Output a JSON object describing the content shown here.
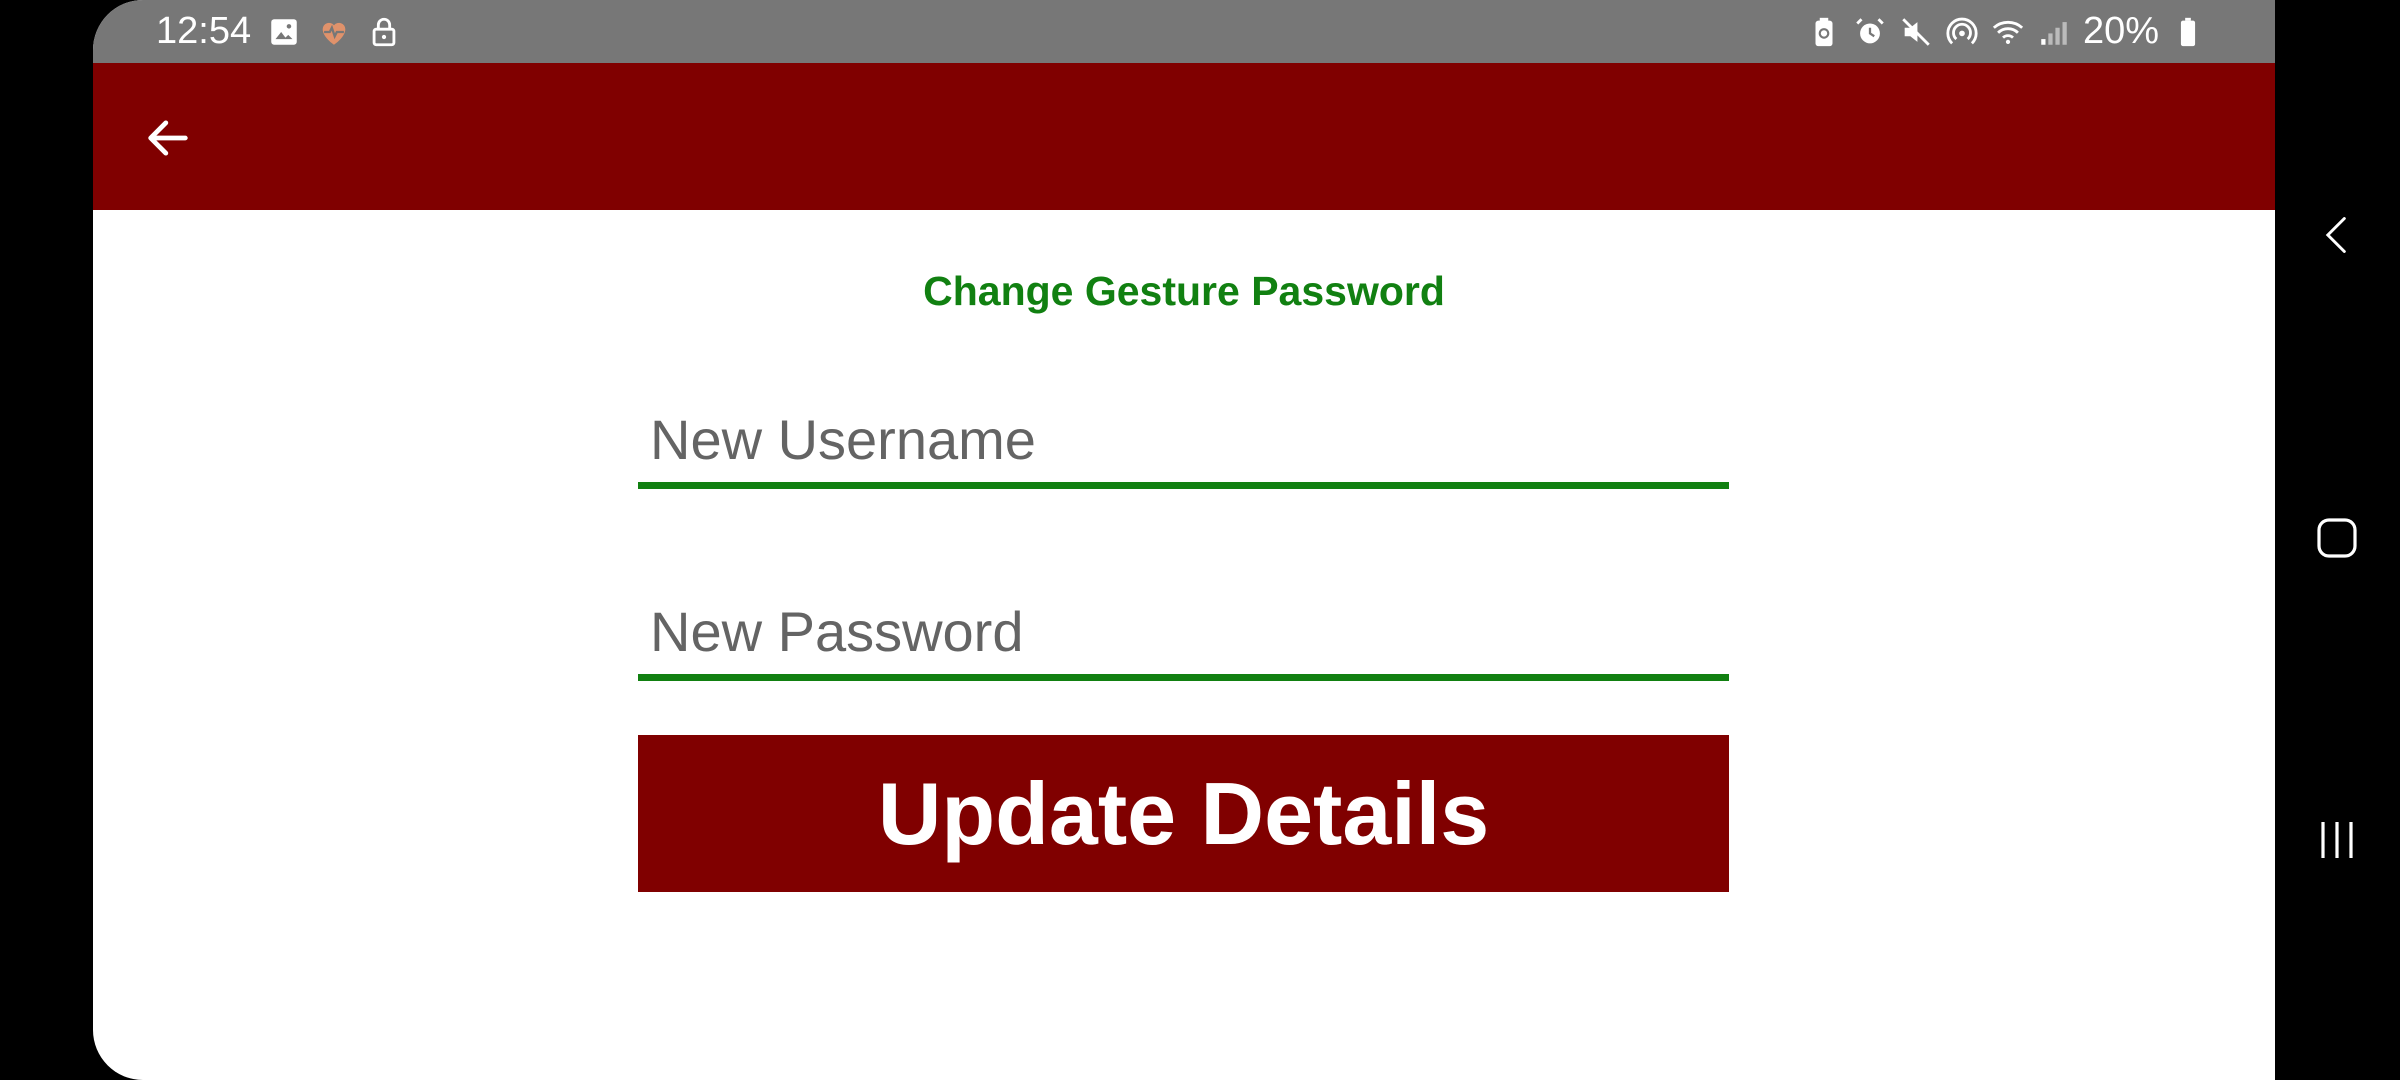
{
  "status_bar": {
    "time": "12:54",
    "left_icons": [
      "image-icon",
      "health-heart-icon",
      "lock-icon"
    ],
    "right_icons": [
      "battery-saver-icon",
      "alarm-icon",
      "mute-icon",
      "hotspot-icon",
      "wifi-icon",
      "signal-icon"
    ],
    "battery_percent": "20%"
  },
  "app_bar": {
    "back_icon": "arrow-left-icon",
    "color": "#800000"
  },
  "form": {
    "title": "Change Gesture Password",
    "username": {
      "placeholder": "New Username",
      "value": ""
    },
    "password": {
      "placeholder": "New Password",
      "value": ""
    },
    "submit_label": "Update Details",
    "accent_color": "#118011"
  },
  "nav_bar": {
    "icons": [
      "nav-back-icon",
      "nav-home-icon",
      "nav-recents-icon"
    ]
  }
}
